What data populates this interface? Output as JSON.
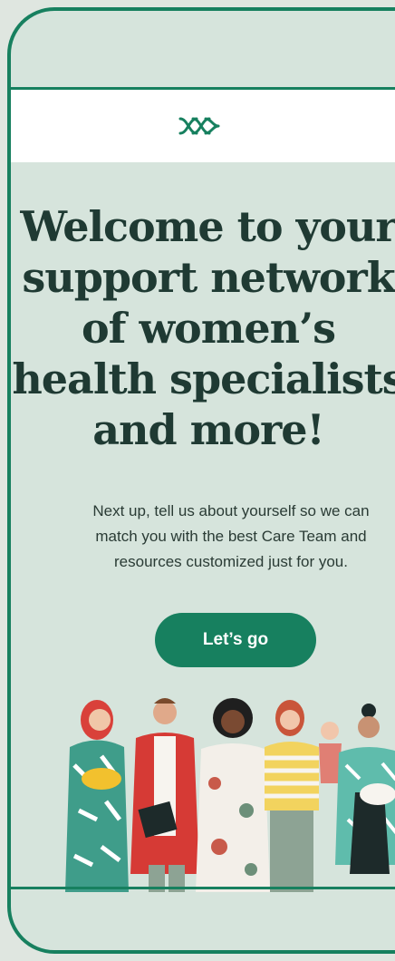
{
  "header": {
    "logo_icon": "interlocking-loops-logo"
  },
  "welcome": {
    "headline_lines": [
      "Welcome to your",
      "support network",
      "of women’s",
      "health specialists",
      "and more!"
    ],
    "subtext_lines": [
      "Next up, tell us about yourself so we can",
      "match you with the best Care Team and",
      "resources customized just for you."
    ],
    "cta_label": "Let’s go"
  },
  "illustration": {
    "description_icon": "group-of-diverse-women-illustration"
  },
  "colors": {
    "brand": "#17805f",
    "background": "#d6e4dc",
    "headline": "#1f3a33"
  }
}
